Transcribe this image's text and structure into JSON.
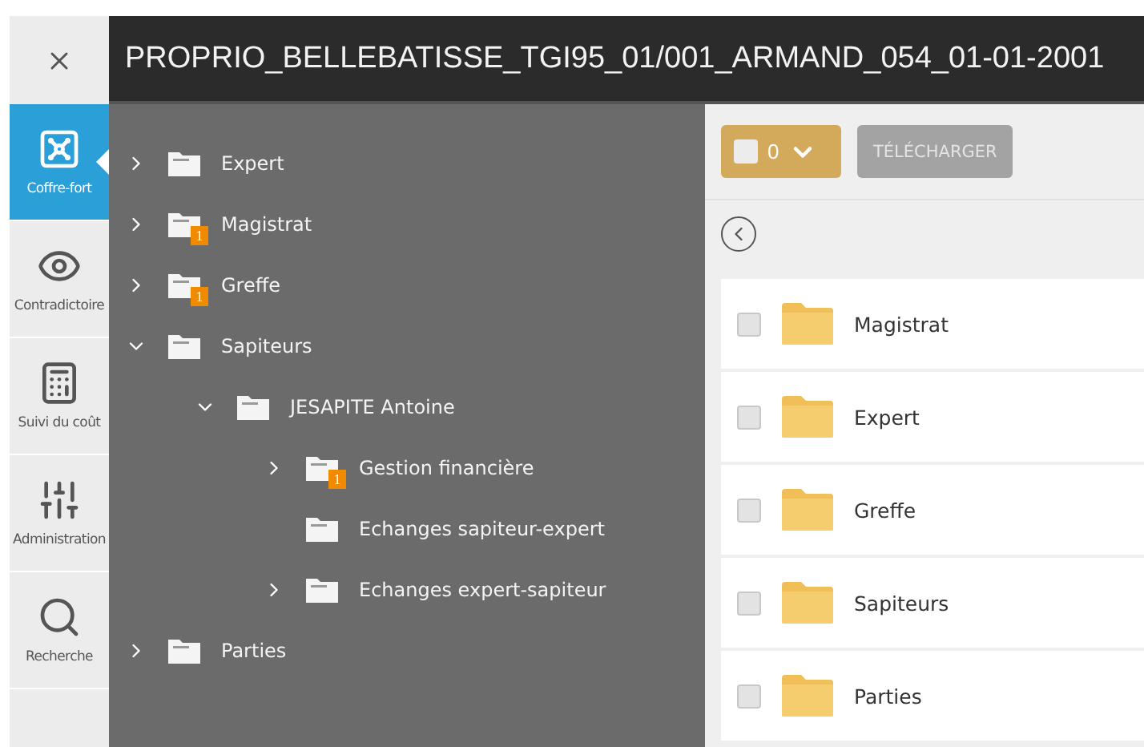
{
  "window": {
    "title": "PROPRIO_BELLEBATISSE_TGI95_01/001_ARMAND_054_01-01-2001"
  },
  "nav": [
    {
      "label": "Coffre-fort",
      "selected": true
    },
    {
      "label": "Contradictoire",
      "selected": false
    },
    {
      "label": "Suivi du coût",
      "selected": false
    },
    {
      "label": "Administration",
      "selected": false
    },
    {
      "label": "Recherche",
      "selected": false
    }
  ],
  "tree": [
    {
      "label": "Expert",
      "expanded": false
    },
    {
      "label": "Magistrat",
      "expanded": false,
      "badge": "1"
    },
    {
      "label": "Greffe",
      "expanded": false,
      "badge": "1"
    },
    {
      "label": "Sapiteurs",
      "expanded": true,
      "children": [
        {
          "label": "JESAPITE Antoine",
          "expanded": true,
          "children": [
            {
              "label": "Gestion financière",
              "expanded": false,
              "badge": "1"
            },
            {
              "label": "Echanges sapiteur-expert"
            },
            {
              "label": "Echanges expert-sapiteur",
              "expanded": false
            }
          ]
        }
      ]
    },
    {
      "label": "Parties",
      "expanded": false
    }
  ],
  "toolbar": {
    "selection": {
      "count": "0",
      "checked": false
    },
    "download": {
      "label": "TÉLÉCHARGER",
      "disabled": true
    }
  },
  "folders": [
    {
      "name": "Magistrat",
      "checked": false
    },
    {
      "name": "Expert",
      "checked": false
    },
    {
      "name": "Greffe",
      "checked": false
    },
    {
      "name": "Sapiteurs",
      "checked": false
    },
    {
      "name": "Parties",
      "checked": false
    }
  ]
}
